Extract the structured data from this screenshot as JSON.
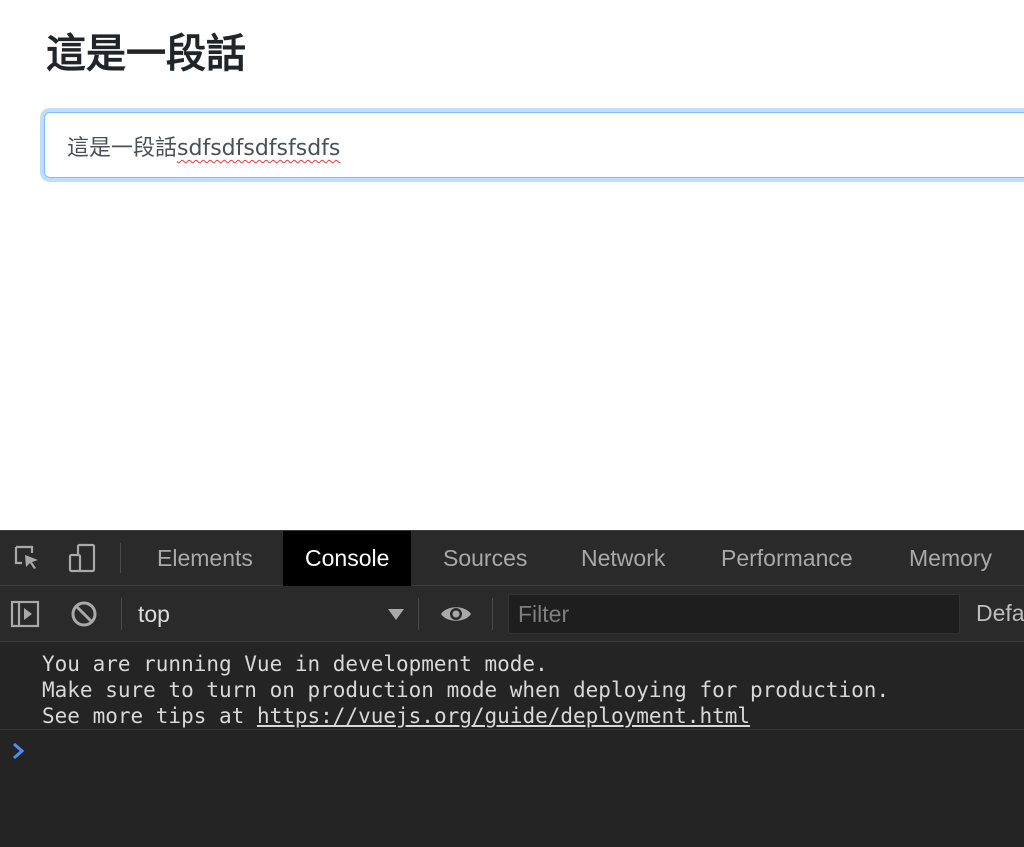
{
  "page": {
    "heading": "這是一段話",
    "input": {
      "value_cjk": "這是一段話",
      "value_latin": "sdfsdfsdfsfsdfs"
    }
  },
  "devtools": {
    "tabs": [
      {
        "label": "Elements",
        "active": false
      },
      {
        "label": "Console",
        "active": true
      },
      {
        "label": "Sources",
        "active": false
      },
      {
        "label": "Network",
        "active": false
      },
      {
        "label": "Performance",
        "active": false
      },
      {
        "label": "Memory",
        "active": false
      }
    ],
    "toolbar": {
      "context": "top",
      "filter_placeholder": "Filter",
      "levels_label": "Defa"
    },
    "messages": {
      "line1": "You are running Vue in development mode.",
      "line2": "Make sure to turn on production mode when deploying for production.",
      "line3_prefix": "See more tips at ",
      "line3_link": "https://vuejs.org/guide/deployment.html"
    },
    "colors": {
      "panel_bg": "#242424",
      "toolbar_bg": "#2a2a2b",
      "active_tab_bg": "#000000",
      "prompt": "#4d8ef5",
      "focus_ring": "#80bdff",
      "spellcheck": "#e03a3a"
    },
    "icons": [
      "inspect-element-icon",
      "device-toolbar-icon",
      "sidebar-toggle-icon",
      "clear-console-icon",
      "eye-icon",
      "prompt-chevron-icon"
    ]
  }
}
